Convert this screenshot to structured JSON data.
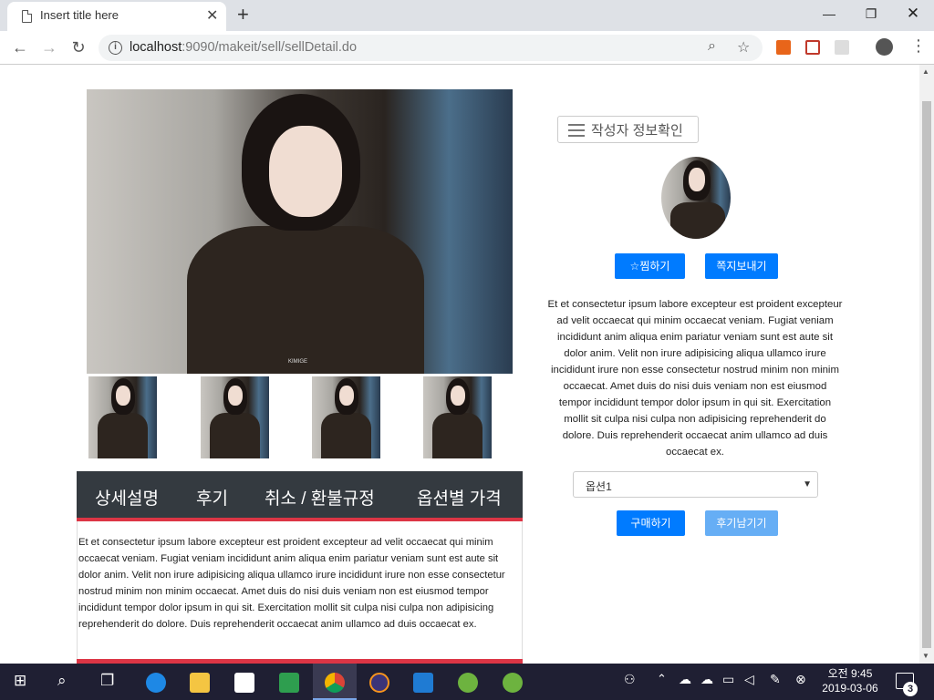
{
  "browser": {
    "tab_title": "Insert title here",
    "url_host": "localhost",
    "url_path": ":9090/makeit/sell/sellDetail.do"
  },
  "gallery": {
    "watermark": "KIMIGE"
  },
  "info_tabs": [
    "상세설명",
    "후기",
    "취소 / 환불규정",
    "옵션별 가격"
  ],
  "description": "Et et consectetur ipsum labore excepteur est proident excepteur ad velit occaecat qui minim occaecat veniam. Fugiat veniam incididunt anim aliqua enim pariatur veniam sunt est aute sit dolor anim. Velit non irure adipisicing aliqua ullamco irure incididunt irure non esse consectetur nostrud minim non minim occaecat. Amet duis do nisi duis veniam non est eiusmod tempor incididunt tempor dolor ipsum in qui sit. Exercitation mollit sit culpa nisi culpa non adipisicing reprehenderit do dolore. Duis reprehenderit occaecat anim ullamco ad duis occaecat ex.",
  "seller": {
    "info_button": "작성자 정보확인",
    "wish_button": "찜하기",
    "message_button": "쪽지보내기",
    "bio": "Et et consectetur ipsum labore excepteur est proident excepteur ad velit occaecat qui minim occaecat veniam. Fugiat veniam incididunt anim aliqua enim pariatur veniam sunt est aute sit dolor anim. Velit non irure adipisicing aliqua ullamco irure incididunt irure non esse consectetur nostrud minim non minim occaecat. Amet duis do nisi duis veniam non est eiusmod tempor incididunt tempor dolor ipsum in qui sit. Exercitation mollit sit culpa nisi culpa non adipisicing reprehenderit do dolore. Duis reprehenderit occaecat anim ullamco ad duis occaecat ex."
  },
  "purchase": {
    "option_selected": "옵션1",
    "buy_button": "구매하기",
    "review_button": "후기남기기"
  },
  "taskbar": {
    "time": "오전 9:45",
    "date": "2019-03-06",
    "notification_count": "3"
  },
  "colors": {
    "primary": "#007bff",
    "tab_bar": "#343a40",
    "accent_red": "#dc3545"
  }
}
